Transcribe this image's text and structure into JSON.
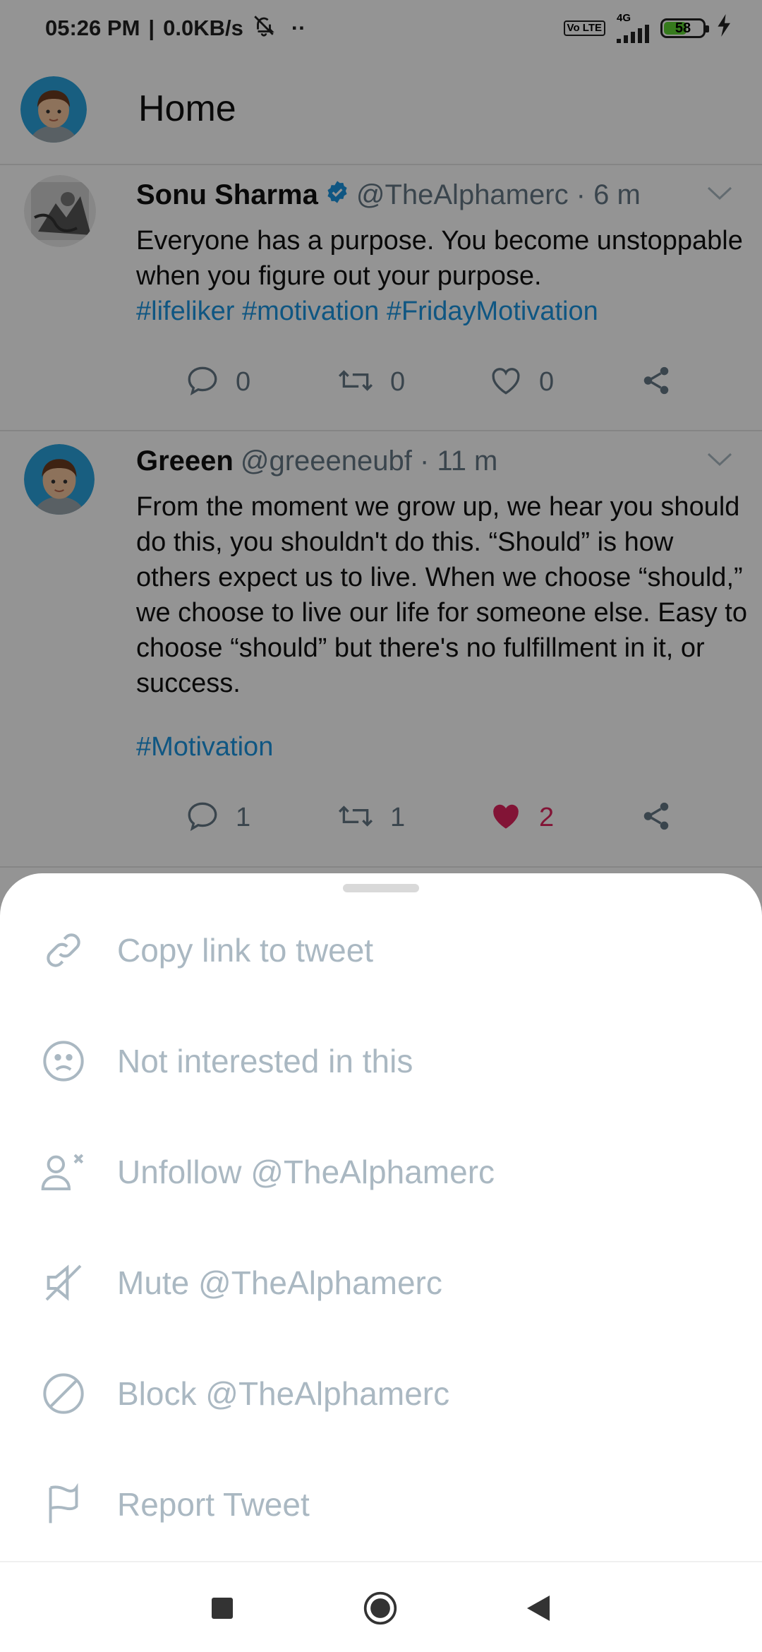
{
  "status_bar": {
    "time": "05:26 PM",
    "speed": "0.0KB/s",
    "more": "··",
    "lte_label": "Vo LTE",
    "network": "4G",
    "battery": "58"
  },
  "header": {
    "title": "Home"
  },
  "tweets": [
    {
      "name": "Sonu Sharma",
      "verified": true,
      "handle": "@TheAlphamerc · 6 m",
      "text": "Everyone has a purpose. You become unstoppable when you figure out your purpose.",
      "hashtags": "#lifeliker #motivation #FridayMotivation",
      "reply_count": "0",
      "retweet_count": "0",
      "like_count": "0"
    },
    {
      "name": "Greeen",
      "verified": false,
      "handle": "@greeeneubf · 11 m",
      "text": "From the moment we grow up, we hear you should do this, you shouldn't do this. “Should” is how others expect us to live. When we choose “should,” we choose to live our life for someone else. Easy to choose “should” but there's no fulfillment in it, or success.",
      "hashtags": "#Motivation",
      "reply_count": "1",
      "retweet_count": "1",
      "like_count": "2"
    }
  ],
  "sheet": {
    "items": [
      {
        "label": "Copy link to tweet",
        "icon": "link-icon"
      },
      {
        "label": "Not interested in this",
        "icon": "sad-face-icon"
      },
      {
        "label": "Unfollow @TheAlphamerc",
        "icon": "unfollow-user-icon"
      },
      {
        "label": "Mute @TheAlphamerc",
        "icon": "mute-speaker-icon"
      },
      {
        "label": "Block @TheAlphamerc",
        "icon": "block-icon"
      },
      {
        "label": "Report Tweet",
        "icon": "flag-icon"
      }
    ]
  },
  "colors": {
    "accent": "#1b95e0",
    "like": "#e0245e",
    "muted_text": "#aab8c2",
    "secondary_text": "#657786",
    "battery_fill": "#5dd433"
  }
}
